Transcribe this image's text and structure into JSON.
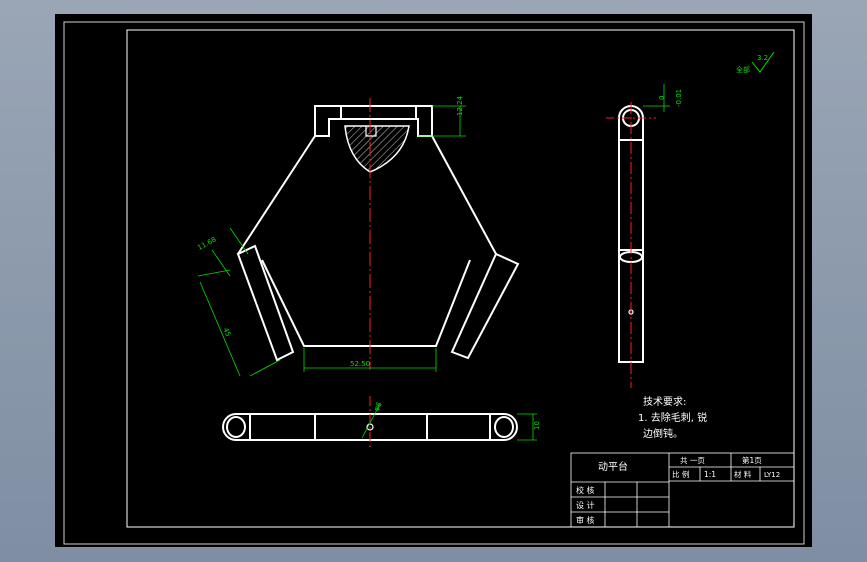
{
  "drawing": {
    "part_title": "动平台",
    "surface_finish": {
      "value": "3.2",
      "label": "全部"
    },
    "dimensions": {
      "top_slot_depth": "12.24",
      "left_edge_width": "11.68",
      "left_side_length": "45",
      "bottom_edge_width": "52.50",
      "bottom_view_thickness": "10",
      "bottom_view_hole": "φ6",
      "side_view_tolerance": "0\n-0.01"
    },
    "tech_requirements": {
      "heading": "技术要求:",
      "line1": "1. 去除毛刺, 锐",
      "line2": "边倒钝。"
    },
    "title_block": {
      "total_pages": "共 一页",
      "page_no": "第1页",
      "scale_label": "比 例",
      "scale_value": "1:1",
      "material_label": "材 料",
      "material_value": "LY12",
      "checker": "校 核",
      "designer": "设 计",
      "approver": "审 核"
    }
  },
  "colors": {
    "background": "#000000",
    "lines": "#ffffff",
    "dimensions": "#00e000",
    "centerline": "#ff2020"
  }
}
